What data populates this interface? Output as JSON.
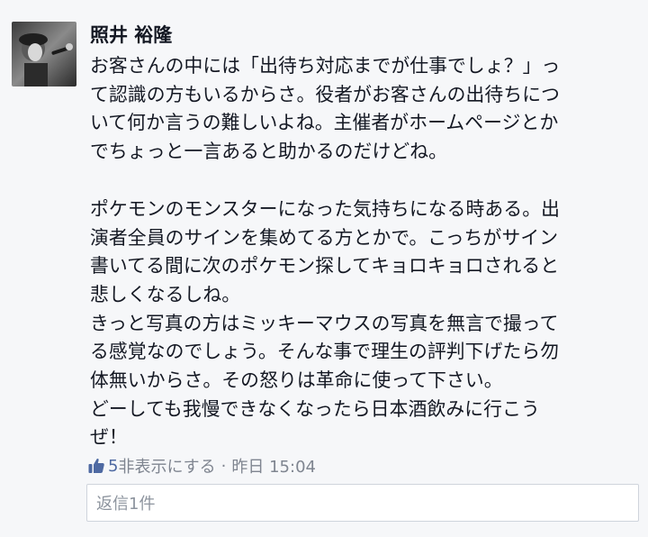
{
  "comment": {
    "author": "照井 裕隆",
    "avatar_icon": "profile-photo-singer-with-microphone",
    "paragraphs": [
      {
        "lines": [
          "お客さんの中には「出待ち対応までが仕事でしょ？」っ",
          "て認識の方もいるからさ。役者がお客さんの出待ちにつ",
          "いて何か言うの難しいよね。主催者がホームページとか",
          "でちょっと一言あると助かるのだけどね。"
        ]
      },
      {
        "lines": [
          "ポケモンのモンスターになった気持ちになる時ある。出",
          "演者全員のサインを集めてる方とかで。こっちがサイン",
          "書いてる間に次のポケモン探してキョロキョロされると",
          "悲しくなるしね。"
        ]
      },
      {
        "lines": [
          "きっと写真の方はミッキーマウスの写真を無言で撮って",
          "る感覚なのでしょう。そんな事で理生の評判下げたら勿",
          "体無いからさ。その怒りは革命に使って下さい。"
        ]
      },
      {
        "lines": [
          "どーしても我慢できなくなったら日本酒飲みに行こう",
          "ぜ！"
        ]
      }
    ],
    "meta": {
      "like_icon": "thumbs-up-icon",
      "like_count": "5",
      "hide_label": "非表示にする",
      "separator": "·",
      "timestamp": "昨日 15:04"
    },
    "reply_label": "返信1件"
  },
  "colors": {
    "background": "#f6f7f9",
    "text": "#141823",
    "meta": "#7f8590",
    "link": "#4e69a2"
  }
}
